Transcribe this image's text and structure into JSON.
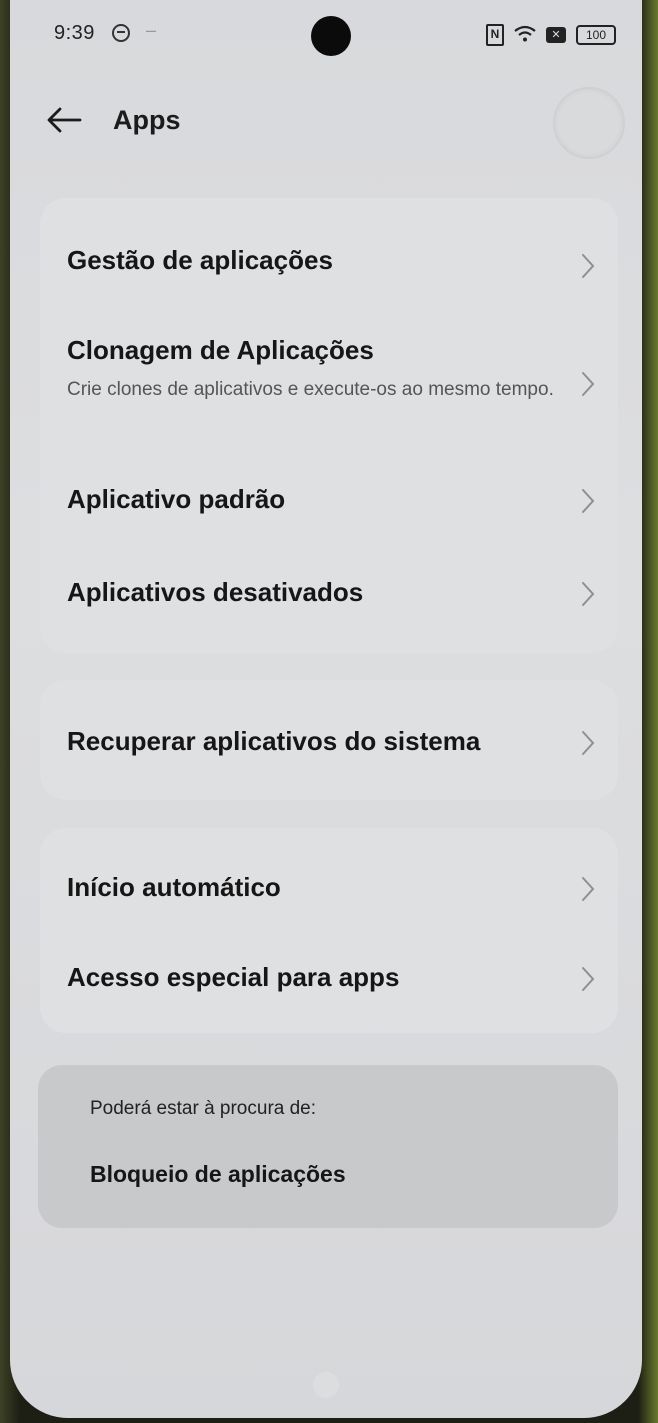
{
  "status_bar": {
    "time": "9:39",
    "dash": "–",
    "nfc": "N",
    "wifi": "≈",
    "sim": "✕",
    "battery": "100"
  },
  "header": {
    "title": "Apps"
  },
  "card1": {
    "items": [
      {
        "title": "Gestão de aplicações"
      },
      {
        "title": "Clonagem de Aplicações",
        "subtitle": "Crie clones de aplicativos e execute-os ao mesmo tempo."
      },
      {
        "title": "Aplicativo padrão"
      },
      {
        "title": "Aplicativos desativados"
      }
    ]
  },
  "card2": {
    "items": [
      {
        "title": "Recuperar aplicativos do sistema"
      }
    ]
  },
  "card3": {
    "items": [
      {
        "title": "Início automático"
      },
      {
        "title": "Acesso especial para apps"
      }
    ]
  },
  "suggestions": {
    "label": "Poderá estar à procura de:",
    "item": "Bloqueio de aplicações"
  },
  "icons": {
    "back": "arrow-left-icon",
    "chevron": "chevron-right-icon"
  },
  "colors": {
    "background": "#dddee0",
    "card": "#dfe0e2",
    "suggestion_card": "#c8c9cb",
    "text": "#161616"
  }
}
